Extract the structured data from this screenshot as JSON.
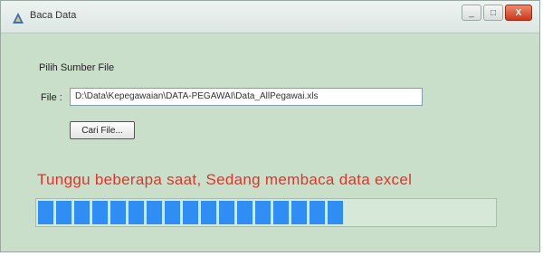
{
  "window": {
    "title": "Baca Data",
    "accent_color": "#2f8ef4",
    "icon": "app-icon"
  },
  "titlebar": {
    "minimize_label": "_",
    "maximize_label": "□",
    "close_label": "X"
  },
  "form": {
    "file_label": "Pilih Sumber File",
    "input_label": "File :",
    "path_value": "D:\\Data\\Kepegawaian\\DATA-PEGAWAI\\Data_AllPegawai.xls",
    "browse_label": "Cari File..."
  },
  "status": {
    "message": "Tunggu beberapa saat, Sedang membaca data excel",
    "color": "#e0342a"
  },
  "progress": {
    "value_fraction": 0.68,
    "filled_segments": 17
  }
}
